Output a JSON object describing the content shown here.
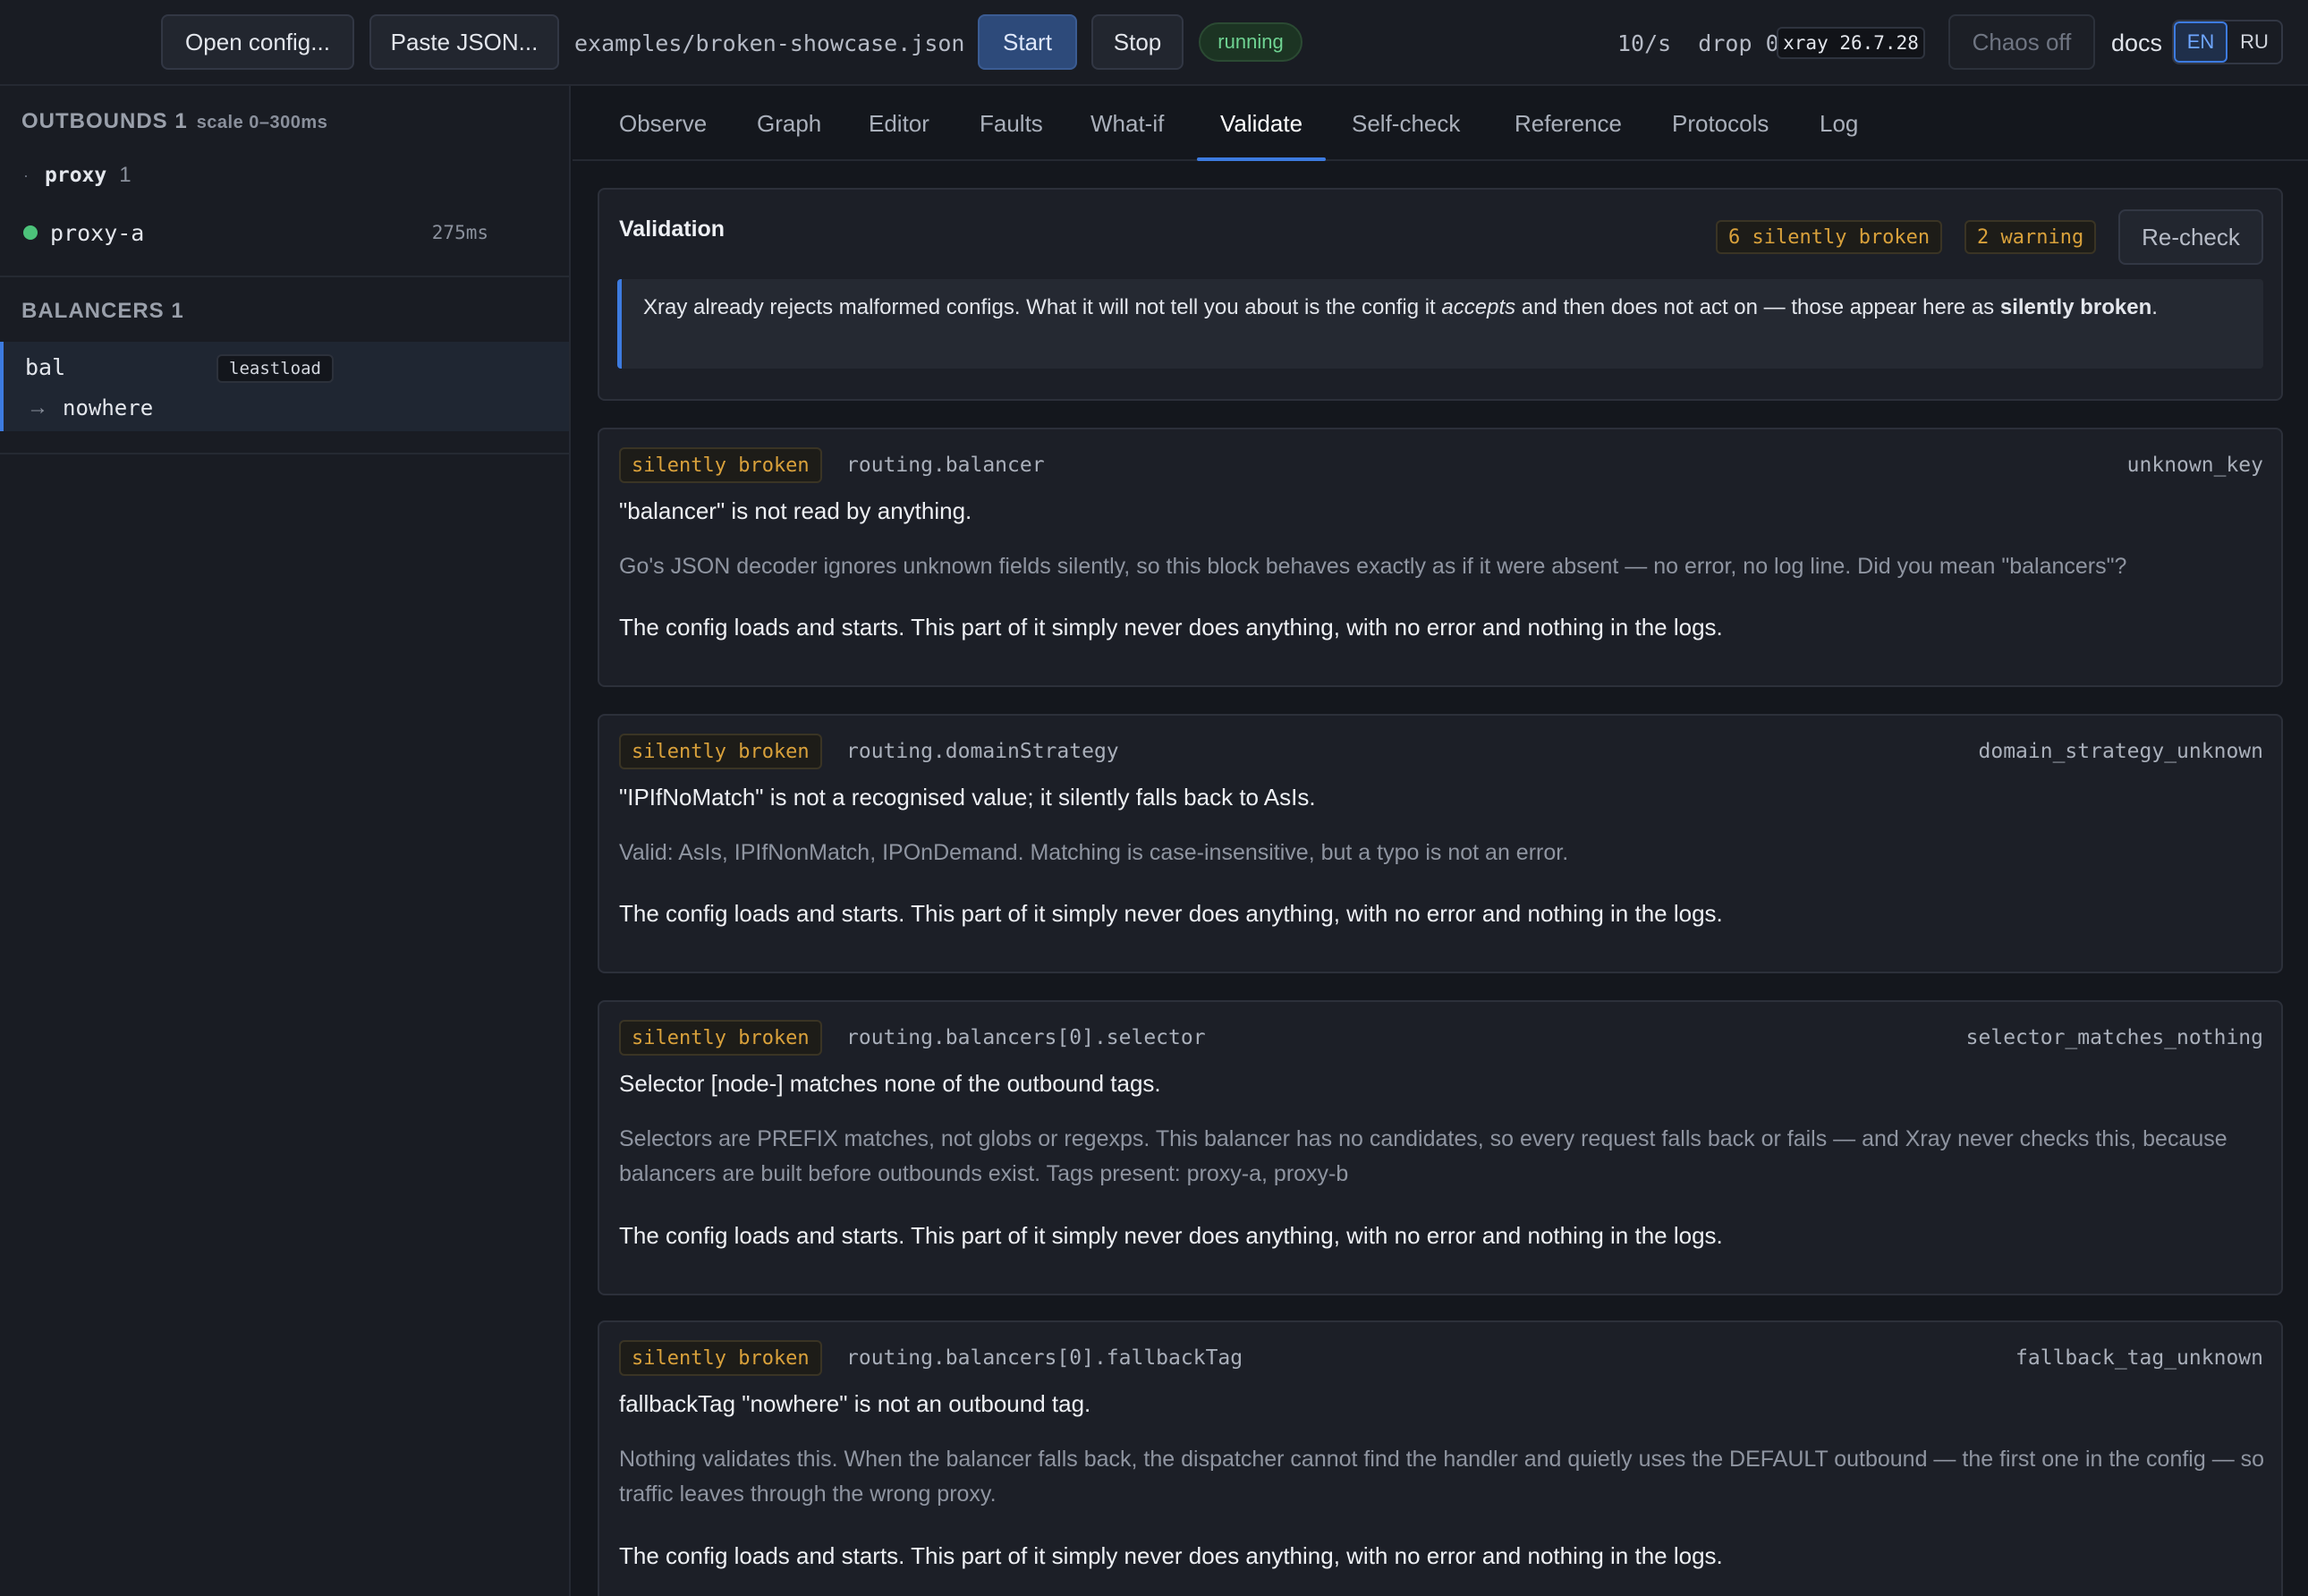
{
  "topbar": {
    "open_config": "Open config...",
    "paste_json": "Paste JSON...",
    "file_path": "examples/broken-showcase.json",
    "start": "Start",
    "stop": "Stop",
    "status": "running",
    "rate": "10/s  drop 0",
    "xray_version": "xray 26.7.28",
    "chaos": "Chaos off",
    "docs": "docs",
    "lang_en": "EN",
    "lang_ru": "RU",
    "colors": {
      "accent": "#3d7be0",
      "running": "#6fd392",
      "warning": "#d9a13b"
    }
  },
  "sidebar": {
    "outbounds_title": "OUTBOUNDS 1",
    "outbounds_scale": "scale 0–300ms",
    "group": {
      "name": "proxy",
      "count": "1"
    },
    "outbound": {
      "name": "proxy-a",
      "latency": "275ms",
      "status": "green-dot"
    },
    "balancers_title": "BALANCERS 1",
    "balancer": {
      "name": "bal",
      "strategy": "leastload",
      "target": "nowhere"
    }
  },
  "tabs": [
    {
      "label": "Observe"
    },
    {
      "label": "Graph"
    },
    {
      "label": "Editor"
    },
    {
      "label": "Faults"
    },
    {
      "label": "What-if"
    },
    {
      "label": "Validate",
      "active": true
    },
    {
      "label": "Self-check"
    },
    {
      "label": "Reference"
    },
    {
      "label": "Protocols"
    },
    {
      "label": "Log"
    }
  ],
  "validation": {
    "title": "Validation",
    "silently_broken_count": "6 silently broken",
    "warning_count": "2 warning",
    "recheck": "Re-check",
    "intro_1": "Xray already rejects malformed configs. What it will not tell you about is the config it ",
    "intro_accepts": "accepts",
    "intro_2": " and then does not act on — those appear here as ",
    "intro_bold": "silently broken",
    "intro_end": "."
  },
  "issues": [
    {
      "badge": "silently broken",
      "path": "routing.balancer",
      "code": "unknown_key",
      "title": "\"balancer\" is not read by anything.",
      "desc": "Go's JSON decoder ignores unknown fields silently, so this block behaves exactly as if it were absent — no error, no log line. Did you mean \"balancers\"?",
      "note": "The config loads and starts. This part of it simply never does anything, with no error and nothing in the logs."
    },
    {
      "badge": "silently broken",
      "path": "routing.domainStrategy",
      "code": "domain_strategy_unknown",
      "title": "\"IPIfNoMatch\" is not a recognised value; it silently falls back to AsIs.",
      "desc": "Valid: AsIs, IPIfNonMatch, IPOnDemand. Matching is case-insensitive, but a typo is not an error.",
      "note": "The config loads and starts. This part of it simply never does anything, with no error and nothing in the logs."
    },
    {
      "badge": "silently broken",
      "path": "routing.balancers[0].selector",
      "code": "selector_matches_nothing",
      "title": "Selector [node-] matches none of the outbound tags.",
      "desc": "Selectors are PREFIX matches, not globs or regexps. This balancer has no candidates, so every request falls back or fails — and Xray never checks this, because balancers are built before outbounds exist. Tags present: proxy-a, proxy-b",
      "note": "The config loads and starts. This part of it simply never does anything, with no error and nothing in the logs."
    },
    {
      "badge": "silently broken",
      "path": "routing.balancers[0].fallbackTag",
      "code": "fallback_tag_unknown",
      "title": "fallbackTag \"nowhere\" is not an outbound tag.",
      "desc": "Nothing validates this. When the balancer falls back, the dispatcher cannot find the handler and quietly uses the DEFAULT outbound — the first one in the config — so traffic leaves through the wrong proxy.",
      "note": "The config loads and starts. This part of it simply never does anything, with no error and nothing in the logs."
    }
  ]
}
